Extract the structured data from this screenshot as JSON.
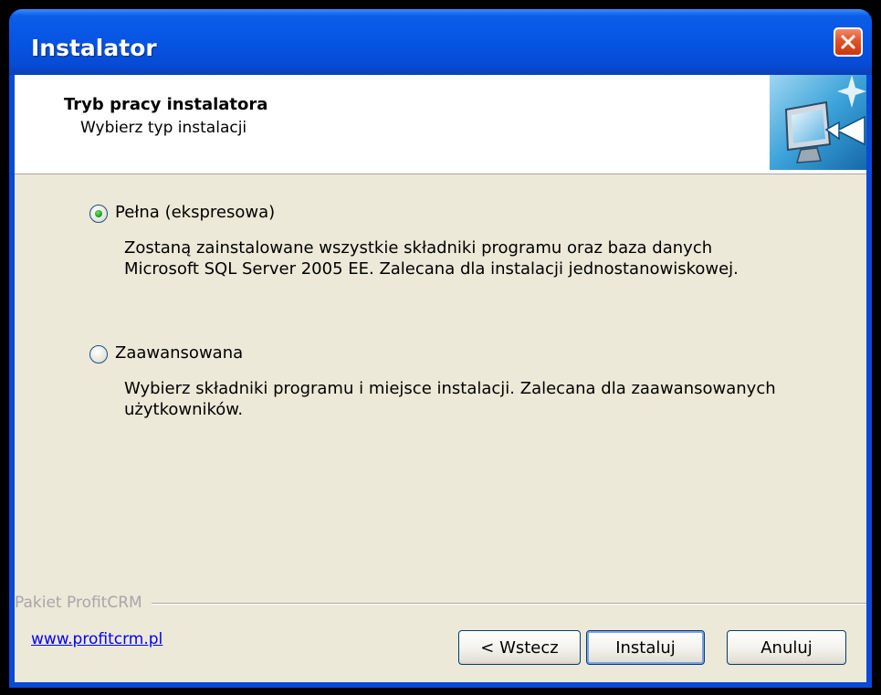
{
  "window": {
    "title": "Instalator"
  },
  "header": {
    "title": "Tryb pracy instalatora",
    "subtitle": "Wybierz typ instalacji"
  },
  "options": [
    {
      "label": "Pełna (ekspresowa)",
      "description": "Zostaną zainstalowane wszystkie składniki programu oraz baza danych Microsoft SQL Server 2005 EE. Zalecana dla instalacji jednostanowiskowej.",
      "selected": true
    },
    {
      "label": "Zaawansowana",
      "description": "Wybierz składniki programu i miejsce instalacji. Zalecana dla zaawansowanych użytkowników.",
      "selected": false
    }
  ],
  "footer": {
    "group_label": "Pakiet ProfitCRM",
    "link": "www.profitcrm.pl"
  },
  "buttons": {
    "back": "< Wstecz",
    "install": "Instaluj",
    "cancel": "Anuluj"
  },
  "colors": {
    "titlebar": "#0653e2",
    "dialog_bg": "#ece9d8",
    "close_button": "#e0522a",
    "radio_dot": "#21a121",
    "link": "#0000ff"
  },
  "icons": [
    "close-icon",
    "installer-computer-icon",
    "radio-selected-icon",
    "radio-unselected-icon"
  ]
}
